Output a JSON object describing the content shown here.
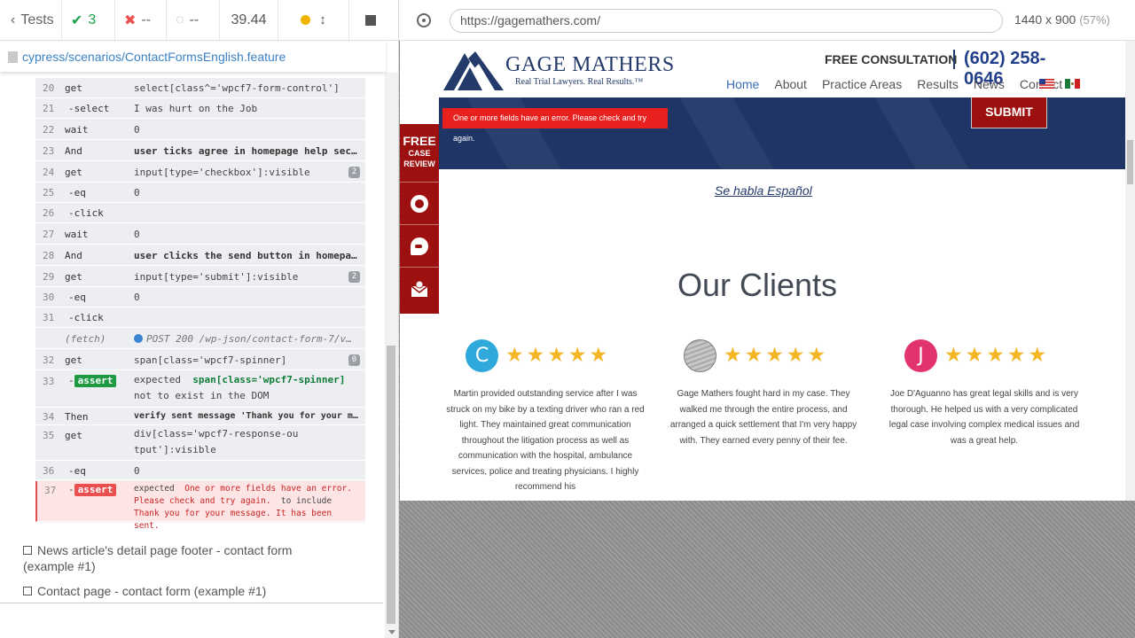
{
  "runner": {
    "tests_label": "Tests",
    "passed": "3",
    "failed": "--",
    "pending": "--",
    "duration": "39.44",
    "spec_path": "cypress/scenarios/ContactFormsEnglish.feature",
    "commands": [
      {
        "num": "20",
        "name": "get",
        "message": "select[class^='wpcf7-form-control']"
      },
      {
        "num": "21",
        "name": "-select",
        "message": "I was hurt on the Job"
      },
      {
        "num": "22",
        "name": "wait",
        "message": "0"
      },
      {
        "num": "23",
        "name": "And",
        "message": "user ticks agree in homepage help sec…"
      },
      {
        "num": "24",
        "name": "get",
        "message": "input[type='checkbox']:visible",
        "badge": "2"
      },
      {
        "num": "25",
        "name": "-eq",
        "message": "0"
      },
      {
        "num": "26",
        "name": "-click",
        "message": ""
      },
      {
        "num": "27",
        "name": "wait",
        "message": "0"
      },
      {
        "num": "28",
        "name": "And",
        "message": "user clicks the send button in homepa…"
      },
      {
        "num": "29",
        "name": "get",
        "message": "input[type='submit']:visible",
        "badge": "2"
      },
      {
        "num": "30",
        "name": "-eq",
        "message": "0"
      },
      {
        "num": "31",
        "name": "-click",
        "message": ""
      },
      {
        "num": "",
        "name": "(fetch)",
        "message": "POST 200 /wp-json/contact-form-7/v…"
      },
      {
        "num": "32",
        "name": "get",
        "message": "span[class='wpcf7-spinner]",
        "badge": "0"
      },
      {
        "num": "33",
        "name": "assert",
        "expected": "expected",
        "subject": "span[class='wpcf7-spinner]",
        "tail": "not to exist in the DOM"
      },
      {
        "num": "34",
        "name": "Then",
        "message": "verify sent message 'Thank you for your mess…"
      },
      {
        "num": "35",
        "name": "get",
        "message": "div[class='wpcf7-response-output']:visible"
      },
      {
        "num": "36",
        "name": "-eq",
        "message": "0"
      },
      {
        "num": "37",
        "name": "assert",
        "expected": "expected",
        "subject": "One or more fields have an error. Please check and try again.",
        "mid": "to include",
        "tail": "Thank you for your message. It has been sent."
      }
    ],
    "other_tests": [
      "News article's detail page footer - contact form (example #1)",
      "Contact page - contact form (example #1)"
    ]
  },
  "browser": {
    "url": "https://gagemathers.com/",
    "viewport": "1440 x 900",
    "zoom": "(57%)"
  },
  "site": {
    "brand": "GAGE MATHERS",
    "tagline": "Real Trial Lawyers. Real Results.™",
    "free_consultation": "FREE CONSULTATION",
    "phone": "(602) 258-0646",
    "nav": [
      "Home",
      "About",
      "Practice Areas",
      "Results",
      "News",
      "Contact"
    ],
    "error_message": "One or more fields have an error. Please check and try again.",
    "submit": "SUBMIT",
    "side_free": "FREE",
    "side_case": "CASE",
    "side_review": "REVIEW",
    "se_habla": "Se habla Español",
    "clients_heading": "Our Clients",
    "reviews": [
      {
        "initial": "C",
        "color": "#2fa9dc",
        "stars": "★★★★★",
        "text": "Martin provided outstanding service after I was struck on my bike by a texting driver who ran a red light. They maintained great communication throughout the litigation process as well as communication with the hospital, ambulance services, police and treating physicians. I highly recommend his"
      },
      {
        "initial": "",
        "color": "#9a9a9a",
        "stars": "★★★★★",
        "text": "Gage Mathers fought hard in my case. They walked me through the entire process, and arranged a quick settlement that I'm very happy with. They earned every penny of their fee."
      },
      {
        "initial": "J",
        "color": "#e2336f",
        "stars": "★★★★★",
        "text": "Joe D'Aguanno has great legal skills and is very thorough. He helped us with a very complicated legal case involving complex medical issues and was a great help."
      }
    ],
    "colors": {
      "navy": "#1e3566",
      "red": "#9c1010",
      "error": "#e8201e",
      "star": "#f4b625"
    }
  }
}
